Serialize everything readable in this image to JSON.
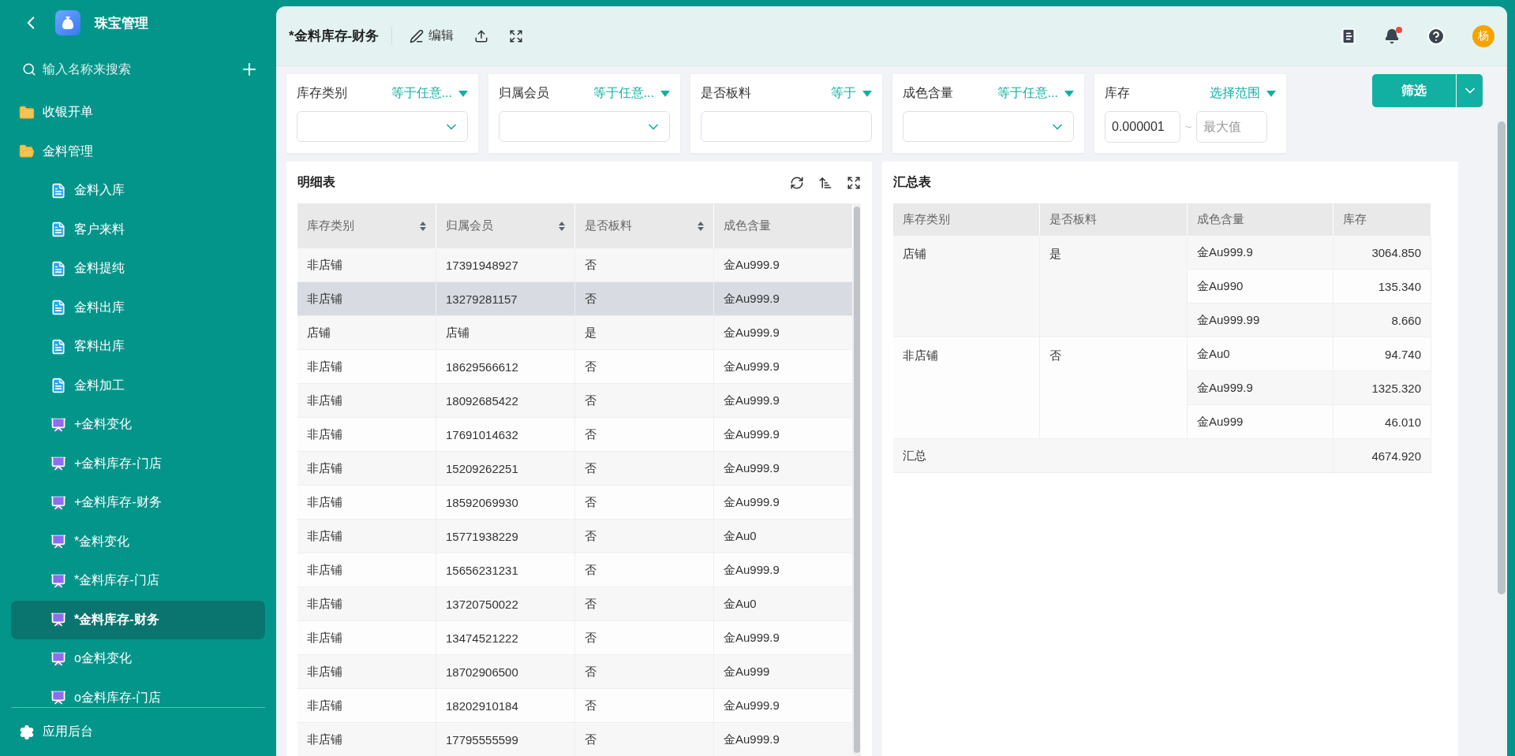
{
  "sidebar": {
    "app_title": "珠宝管理",
    "search": {
      "placeholder": "输入名称来搜索"
    },
    "items": [
      {
        "label": "收银开单",
        "kind": "folder",
        "expanded": false,
        "selected": false
      },
      {
        "label": "金料管理",
        "kind": "folder",
        "expanded": true,
        "selected": false,
        "children": [
          {
            "label": "金料入库",
            "kind": "form",
            "selected": false
          },
          {
            "label": "客户来料",
            "kind": "form",
            "selected": false
          },
          {
            "label": "金料提纯",
            "kind": "form",
            "selected": false
          },
          {
            "label": "金料出库",
            "kind": "form",
            "selected": false
          },
          {
            "label": "客料出库",
            "kind": "form",
            "selected": false
          },
          {
            "label": "金料加工",
            "kind": "form",
            "selected": false
          },
          {
            "label": "+金料变化",
            "kind": "report",
            "selected": false
          },
          {
            "label": "+金料库存-门店",
            "kind": "report",
            "selected": false
          },
          {
            "label": "+金料库存-财务",
            "kind": "report",
            "selected": false
          },
          {
            "label": "*金料变化",
            "kind": "report",
            "selected": false
          },
          {
            "label": "*金料库存-门店",
            "kind": "report",
            "selected": false
          },
          {
            "label": "*金料库存-财务",
            "kind": "report",
            "selected": true
          },
          {
            "label": "o金料变化",
            "kind": "report",
            "selected": false
          },
          {
            "label": "o金料库存-门店",
            "kind": "report",
            "selected": false
          }
        ]
      }
    ],
    "footer": "应用后台"
  },
  "header": {
    "title": "*金料库存-财务",
    "edit": "编辑",
    "avatar": "杨",
    "notification": true
  },
  "filters": [
    {
      "kind": "select",
      "label": "库存类别",
      "operator": "等于任意..."
    },
    {
      "kind": "select",
      "label": "归属会员",
      "operator": "等于任意..."
    },
    {
      "kind": "text",
      "label": "是否板料",
      "operator": "等于"
    },
    {
      "kind": "select",
      "label": "成色含量",
      "operator": "等于任意..."
    },
    {
      "kind": "range",
      "label": "库存",
      "operator": "选择范围",
      "min": "0.000001",
      "separator": "~",
      "max_placeholder": "最大值"
    }
  ],
  "filter_button": "筛选",
  "detail": {
    "title": "明细表",
    "columns": [
      {
        "label": "库存类别",
        "sortable": true
      },
      {
        "label": "归属会员",
        "sortable": true
      },
      {
        "label": "是否板料",
        "sortable": true
      },
      {
        "label": "成色含量",
        "sortable": false
      }
    ],
    "rows": [
      {
        "cells": [
          "非店铺",
          "17391948927",
          "否",
          "金Au999.9"
        ],
        "selected": false
      },
      {
        "cells": [
          "非店铺",
          "13279281157",
          "否",
          "金Au999.9"
        ],
        "selected": true
      },
      {
        "cells": [
          "店铺",
          "店铺",
          "是",
          "金Au999.9"
        ],
        "selected": false
      },
      {
        "cells": [
          "非店铺",
          "18629566612",
          "否",
          "金Au999.9"
        ],
        "selected": false
      },
      {
        "cells": [
          "非店铺",
          "18092685422",
          "否",
          "金Au999.9"
        ],
        "selected": false
      },
      {
        "cells": [
          "非店铺",
          "17691014632",
          "否",
          "金Au999.9"
        ],
        "selected": false
      },
      {
        "cells": [
          "非店铺",
          "15209262251",
          "否",
          "金Au999.9"
        ],
        "selected": false
      },
      {
        "cells": [
          "非店铺",
          "18592069930",
          "否",
          "金Au999.9"
        ],
        "selected": false
      },
      {
        "cells": [
          "非店铺",
          "15771938229",
          "否",
          "金Au0"
        ],
        "selected": false
      },
      {
        "cells": [
          "非店铺",
          "15656231231",
          "否",
          "金Au999.9"
        ],
        "selected": false
      },
      {
        "cells": [
          "非店铺",
          "13720750022",
          "否",
          "金Au0"
        ],
        "selected": false
      },
      {
        "cells": [
          "非店铺",
          "13474521222",
          "否",
          "金Au999.9"
        ],
        "selected": false
      },
      {
        "cells": [
          "非店铺",
          "18702906500",
          "否",
          "金Au999"
        ],
        "selected": false
      },
      {
        "cells": [
          "非店铺",
          "18202910184",
          "否",
          "金Au999.9"
        ],
        "selected": false
      },
      {
        "cells": [
          "非店铺",
          "17795555599",
          "否",
          "金Au999.9"
        ],
        "selected": false
      }
    ]
  },
  "summary": {
    "title": "汇总表",
    "columns": [
      "库存类别",
      "是否板料",
      "成色含量",
      "库存"
    ],
    "groups": [
      {
        "category": "店铺",
        "board": "是",
        "items": [
          {
            "purity": "金Au999.9",
            "stock": "3064.850"
          },
          {
            "purity": "金Au990",
            "stock": "135.340"
          },
          {
            "purity": "金Au999.99",
            "stock": "8.660"
          }
        ]
      },
      {
        "category": "非店铺",
        "board": "否",
        "items": [
          {
            "purity": "金Au0",
            "stock": "94.740"
          },
          {
            "purity": "金Au999.9",
            "stock": "1325.320"
          },
          {
            "purity": "金Au999",
            "stock": "46.010"
          }
        ]
      }
    ],
    "total": {
      "label": "汇总",
      "value": "4674.920"
    }
  }
}
